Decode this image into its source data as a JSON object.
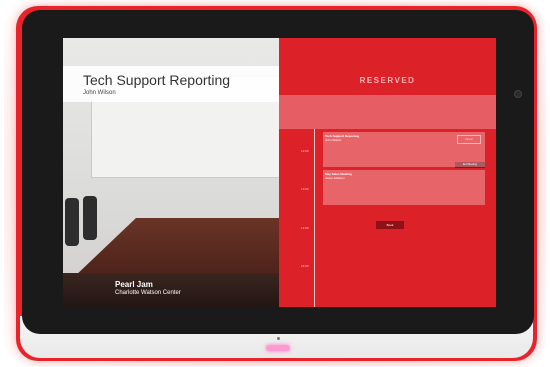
{
  "left_panel": {
    "meeting_title": "Tech Support Reporting",
    "meeting_host": "John Wilson",
    "room_name": "Pearl Jam",
    "room_location": "Charlotte Watson Center"
  },
  "right_panel": {
    "status": "RESERVED",
    "end_meeting_label": "End Meeting",
    "book_label": "Book",
    "times": [
      "12:00",
      "13:00",
      "14:00",
      "15:00"
    ],
    "events": [
      {
        "title": "Tech Support Reporting",
        "host": "John Wilson",
        "cancel_label": "Cancel"
      },
      {
        "title": "May Sales Meeting",
        "host": "Jason Addison"
      }
    ]
  },
  "colors": {
    "status_red": "#dd2128",
    "button_dark_red": "#8c1217",
    "bezel_red": "#e8242a",
    "home_light_pink": "#ff9ad0"
  }
}
